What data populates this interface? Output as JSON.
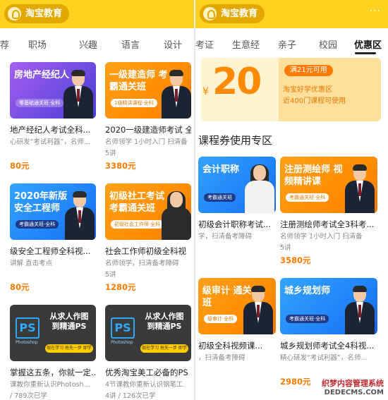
{
  "left": {
    "logo": "淘宝教育",
    "tabs": [
      "荐",
      "职场",
      "兴趣",
      "语言",
      "设计"
    ],
    "cards": [
      {
        "thumb_title": "房地产经纪人",
        "thumb_sub": "零基础通关班·全科",
        "title": "地产经纪人考试全科...",
        "desc": "心研发“考试利器”，名师...",
        "meta": "",
        "price": "80元"
      },
      {
        "thumb_title": "一级建造师 考霸通关班",
        "thumb_sub": "1级精讲课程·全科",
        "title": "2020一级建造师考试 全",
        "desc": "名师领学 1小时入门 扫清备",
        "meta": "5讲",
        "price": "3380元"
      },
      {
        "thumb_title": "2020年新版 安全工程师",
        "thumb_sub": "考霸通关班·全科",
        "title": "级安全工程师全科视...",
        "desc": "讲解 直击考点",
        "meta": "",
        "price": "80元"
      },
      {
        "thumb_title": "初级社工考试 考霸通关班",
        "thumb_sub": "初级社会工作师·全科",
        "title": "社会工作师初级全科视",
        "desc": "名师领学，扫清备考障碍",
        "meta": "5讲",
        "price": "1280元"
      },
      {
        "ps_logo": "PS",
        "ps_small": "Photoshop",
        "ps_title": "从求人作图 到精通PS",
        "ps_chip": "现在学习 抢先一步 即学即用",
        "title": "掌握这五条，你就一定...",
        "desc": "课教你重新认识Photosh...",
        "meta": "/ 789次已学",
        "price": ""
      },
      {
        "ps_logo": "PS",
        "ps_small": "Photoshop",
        "ps_title": "从求人作图 到精通PS",
        "ps_chip": "现在学习 抢先一步 即学即用",
        "title": "优秀淘宝美工必备的PS",
        "desc": "4节课教你重新认识钢笔工",
        "meta": "4讲 / 126次已学",
        "price": ""
      }
    ]
  },
  "right": {
    "logo": "淘宝教育",
    "more": "···",
    "tabs": [
      "考证",
      "生意经",
      "亲子",
      "校园",
      "优惠区"
    ],
    "coupon": {
      "yen": "¥",
      "amount": "20",
      "tag": "满21元可用",
      "note1": "淘宝好学优惠区",
      "note2": "近400门课程可使用"
    },
    "section_title": "课程券使用专区",
    "cards": [
      {
        "thumb_title": "会计职称",
        "thumb_sub": "考霸通关班",
        "title": "初级会计职称考试...",
        "desc": "学，扫清备考障碍",
        "meta": "",
        "price": ""
      },
      {
        "thumb_title": "注册测绘师 视频精讲课",
        "thumb_sub": "考霸通关班·全科",
        "title": "注册测绘师考试全3科考...",
        "desc": "名师领学 1小时入门 扫清备",
        "meta": "5讲",
        "price": "3580元"
      },
      {
        "thumb_title": "级审计 通关班",
        "thumb_sub": "级审计·全科",
        "title": "初级全科视频课...",
        "desc": "，扫清备考障碍",
        "meta": "",
        "price": ""
      },
      {
        "thumb_title": "城乡规划师",
        "thumb_sub": "考霸通关班·全科",
        "title": "城乡规划师考试全4科视...",
        "desc": "精心研发“考试利器”，名师...",
        "meta": "",
        "price": "2980元"
      }
    ]
  },
  "watermark": {
    "text": "织梦内容管理系统",
    "url": "DEDECMS.COM"
  },
  "colors": {
    "brand_yellow": "#ffd21f",
    "price_orange": "#ff7a00"
  }
}
